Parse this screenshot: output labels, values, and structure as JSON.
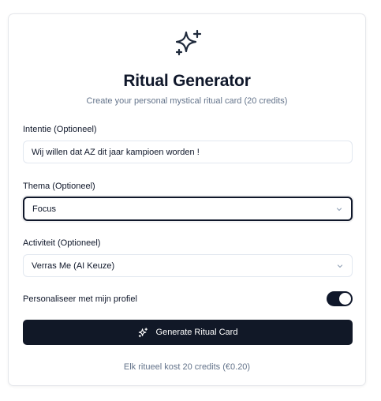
{
  "header": {
    "title": "Ritual Generator",
    "subtitle": "Create your personal mystical ritual card (20 credits)",
    "icon": "sparkles-icon"
  },
  "form": {
    "intention": {
      "label": "Intentie (Optioneel)",
      "value": "Wij willen dat AZ dit jaar kampioen worden !"
    },
    "theme": {
      "label": "Thema (Optioneel)",
      "selected": "Focus"
    },
    "activity": {
      "label": "Activiteit (Optioneel)",
      "selected": "Verras Me (AI Keuze)"
    },
    "personalize": {
      "label": "Personaliseer met mijn profiel",
      "enabled": true
    }
  },
  "actions": {
    "generate_label": "Generate Ritual Card"
  },
  "footer": {
    "note": "Elk ritueel kost 20 credits (€0.20)"
  },
  "colors": {
    "primary": "#111827",
    "muted_text": "#64748b",
    "border": "#e2e8f0"
  }
}
